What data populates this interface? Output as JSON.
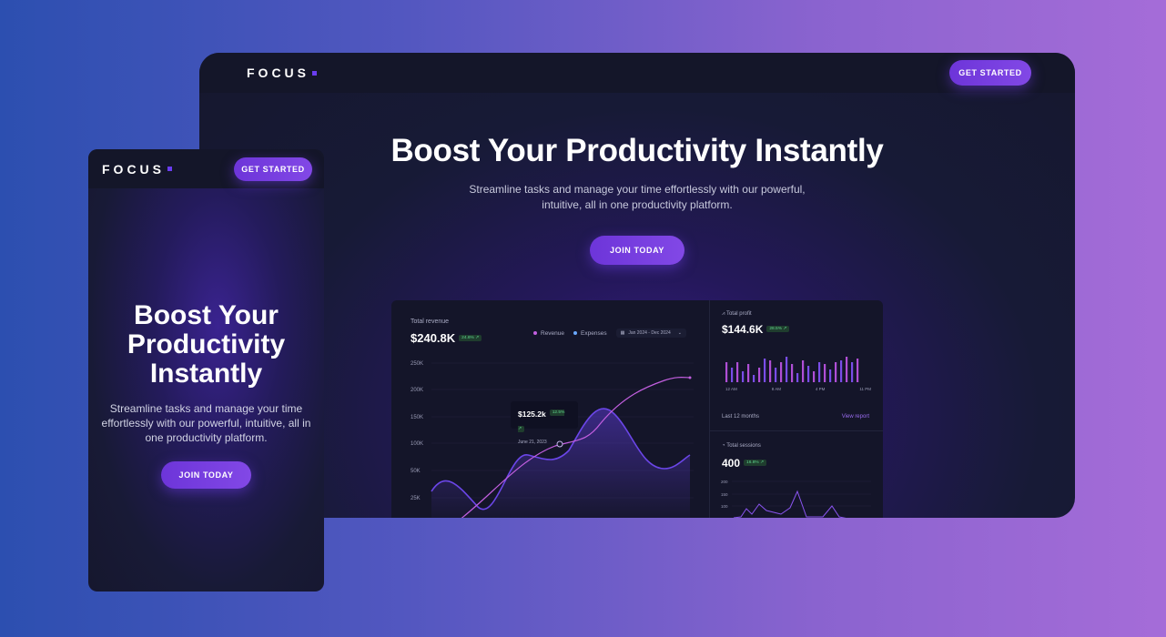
{
  "brand": {
    "name": "FOCUS",
    "accent": "#6a3df0"
  },
  "desktop": {
    "nav_cta": "GET STARTED",
    "title": "Boost Your Productivity Instantly",
    "subtitle": "Streamline tasks and manage your time effortlessly with our powerful, intuitive, all in one productivity platform.",
    "cta": "JOIN TODAY",
    "dashboard": {
      "revenue": {
        "label": "Total revenue",
        "value": "$240.8K",
        "change": "24.6% ↗",
        "legend": [
          "Revenue",
          "Expenses"
        ],
        "date_range": "Jan 2024 - Dec 2024",
        "y_ticks": [
          "250K",
          "200K",
          "150K",
          "100K",
          "50K",
          "25K"
        ],
        "tooltip_value": "$125.2k",
        "tooltip_change": "12.5% ↗",
        "tooltip_date": "June 21, 2023"
      },
      "profit": {
        "label": "Total profit",
        "value": "$144.6K",
        "change": "28.5% ↗",
        "x_ticks": [
          "12 AM",
          "8 AM",
          "4 PM",
          "11 PM"
        ],
        "footer_left": "Last 12 months",
        "footer_right": "View report"
      },
      "sessions": {
        "label": "Total sessions",
        "value": "400",
        "change": "16.8% ↗",
        "y_ticks": [
          "200",
          "150",
          "100"
        ]
      }
    }
  },
  "mobile": {
    "nav_cta": "GET STARTED",
    "title_lines": [
      "Boost Your",
      "Productivity",
      "Instantly"
    ],
    "subtitle": "Streamline tasks and manage your time effortlessly with our powerful, intuitive, all in one productivity platform.",
    "cta": "JOIN TODAY"
  }
}
